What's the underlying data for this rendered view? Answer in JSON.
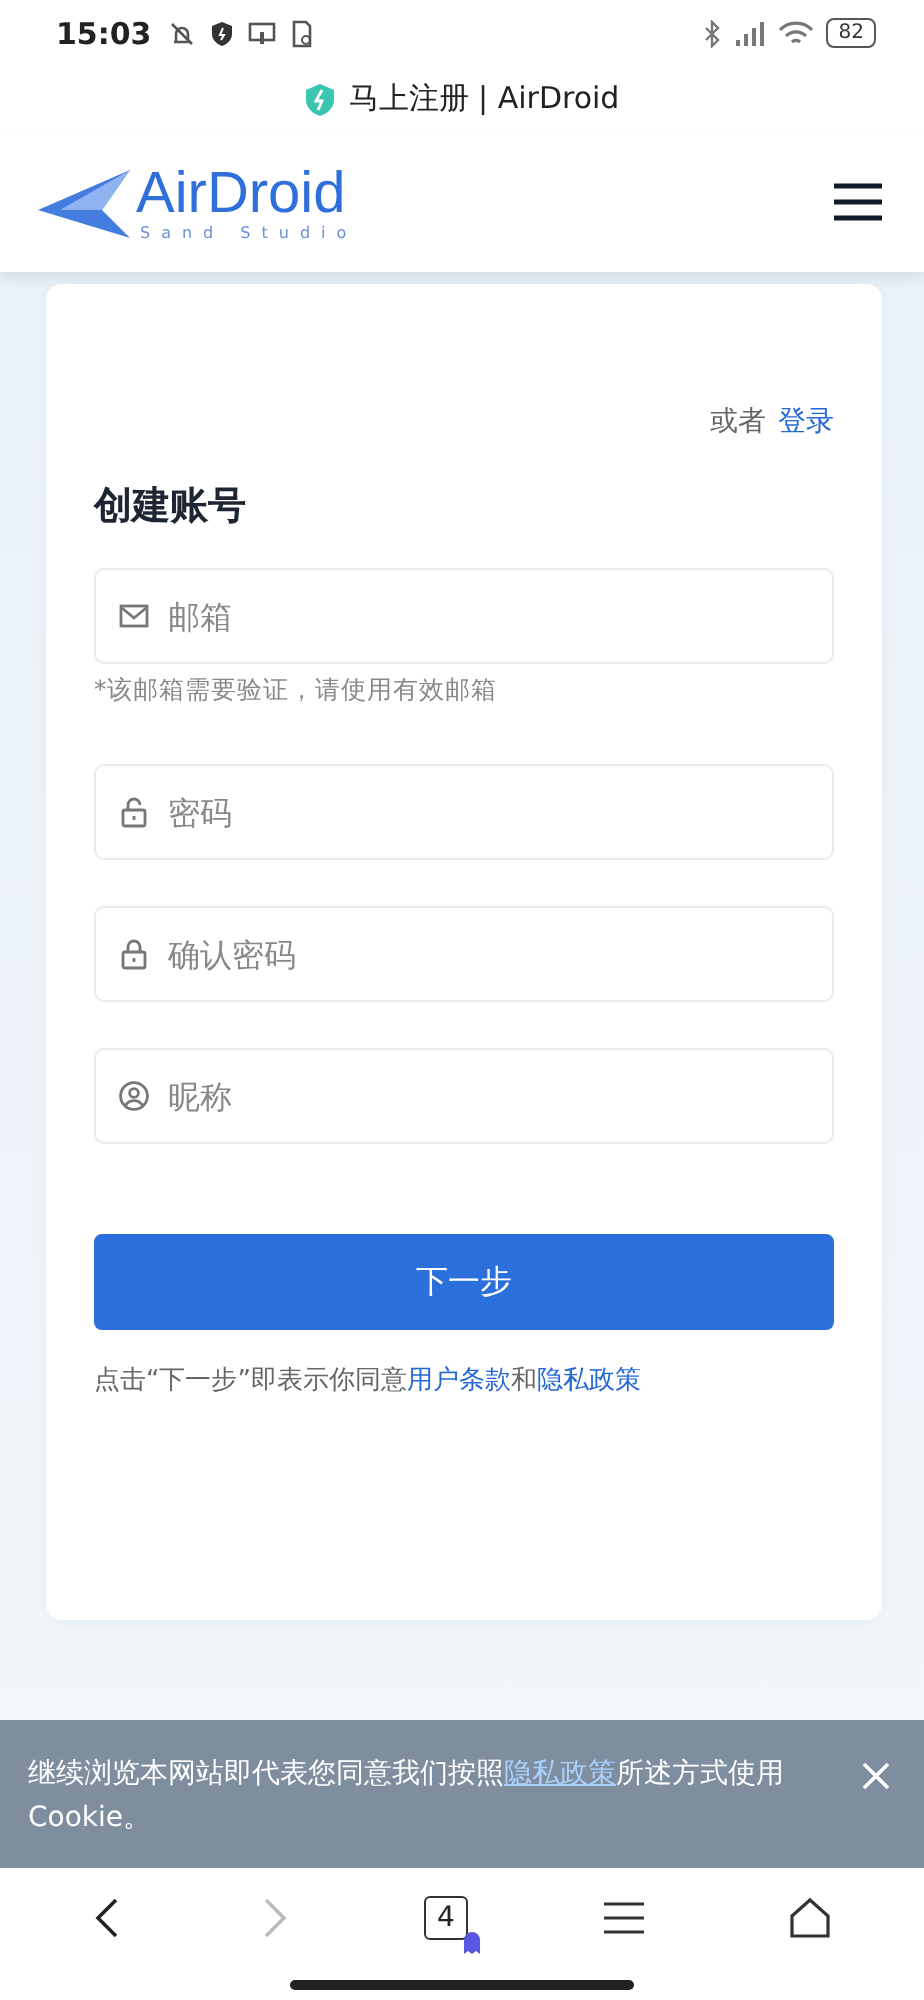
{
  "status_bar": {
    "time": "15:03",
    "battery": "82"
  },
  "browser_title": "马上注册 | AirDroid",
  "header": {
    "logo_name": "AirDroid",
    "logo_tagline": "Sand Studio"
  },
  "card": {
    "login_prompt": "或者",
    "login_link": "登录",
    "title": "创建账号",
    "fields": [
      {
        "kind": "email",
        "placeholder": "邮箱",
        "hint": "*该邮箱需要验证，请使用有效邮箱"
      },
      {
        "kind": "password",
        "placeholder": "密码"
      },
      {
        "kind": "confirm",
        "placeholder": "确认密码"
      },
      {
        "kind": "nickname",
        "placeholder": "昵称"
      }
    ],
    "submit": "下一步",
    "terms": {
      "prefix": "点击“下一步”即表示你同意",
      "link_1": "用户条款",
      "middle": "和",
      "link_2": "隐私政策"
    }
  },
  "cookie_banner": {
    "prefix": "继续浏览本网站即代表您同意我们按照",
    "link": "隐私政策",
    "suffix": "所述方式使用Cookie。"
  },
  "bottom_nav": {
    "tab_count": "4"
  }
}
